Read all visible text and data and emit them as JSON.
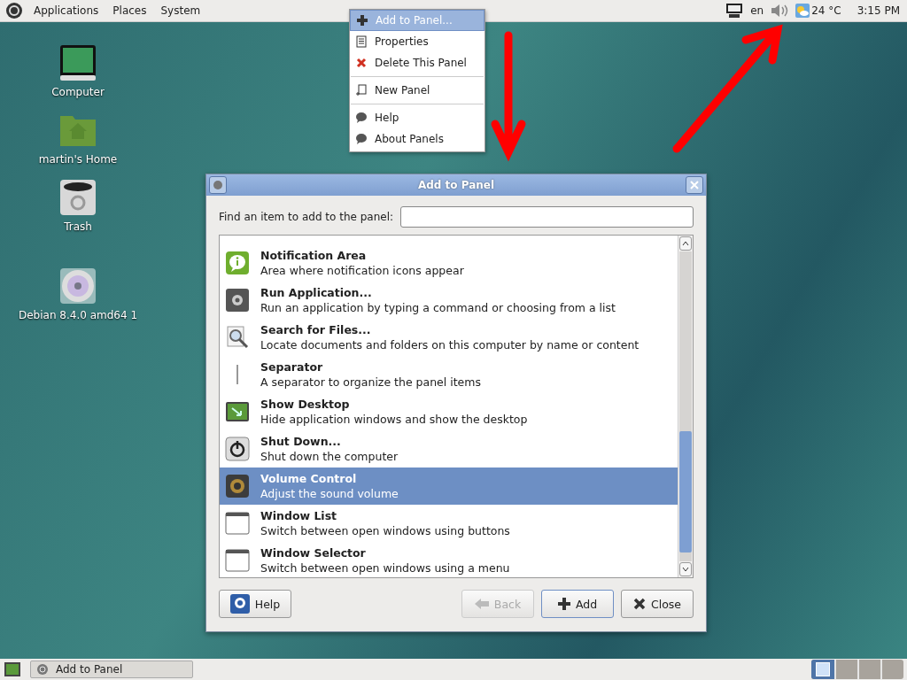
{
  "top_panel": {
    "menus": [
      "Applications",
      "Places",
      "System"
    ],
    "language": "en",
    "temperature": "24 °C",
    "clock": "3:15 PM"
  },
  "desktop_icons": [
    "Computer",
    "martin's Home",
    "Trash",
    "Debian 8.4.0 amd64 1"
  ],
  "context_menu": {
    "items": [
      {
        "label": "Add to Panel...",
        "selected": true
      },
      {
        "label": "Properties",
        "selected": false
      },
      {
        "label": "Delete This Panel",
        "selected": false
      },
      {
        "label": "New Panel",
        "selected": false,
        "separator_before": true
      },
      {
        "label": "Help",
        "selected": false,
        "separator_before": true
      },
      {
        "label": "About Panels",
        "selected": false
      }
    ]
  },
  "dialog": {
    "title": "Add to Panel",
    "search_label": "Find an item to add to the panel:",
    "items": [
      {
        "name": "Notification Area",
        "description": "Area where notification icons appear",
        "selected": false
      },
      {
        "name": "Run Application...",
        "description": "Run an application by typing a command or choosing from a list",
        "selected": false
      },
      {
        "name": "Search for Files...",
        "description": "Locate documents and folders on this computer by name or content",
        "selected": false
      },
      {
        "name": "Separator",
        "description": "A separator to organize the panel items",
        "selected": false
      },
      {
        "name": "Show Desktop",
        "description": "Hide application windows and show the desktop",
        "selected": false
      },
      {
        "name": "Shut Down...",
        "description": "Shut down the computer",
        "selected": false
      },
      {
        "name": "Volume Control",
        "description": "Adjust the sound volume",
        "selected": true
      },
      {
        "name": "Window List",
        "description": "Switch between open windows using buttons",
        "selected": false
      },
      {
        "name": "Window Selector",
        "description": "Switch between open windows using a menu",
        "selected": false
      }
    ],
    "buttons": [
      {
        "label": "Help",
        "kind": "help",
        "disabled": false
      },
      {
        "label": "Back",
        "kind": "back",
        "disabled": true
      },
      {
        "label": "Add",
        "kind": "add",
        "disabled": false
      },
      {
        "label": "Close",
        "kind": "close",
        "disabled": false
      }
    ]
  },
  "bottom_panel": {
    "task": "Add to Panel",
    "workspaces": [
      {
        "selected": true
      },
      {
        "selected": false
      },
      {
        "selected": false
      },
      {
        "selected": false
      }
    ]
  }
}
